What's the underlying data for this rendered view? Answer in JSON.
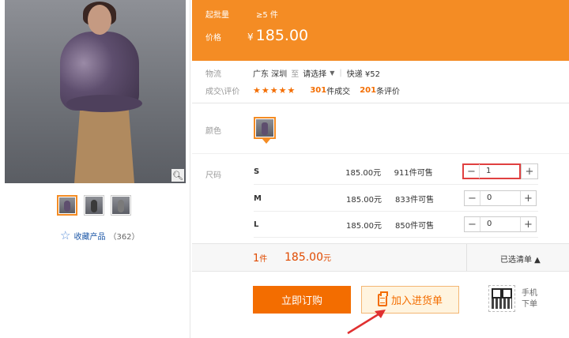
{
  "gallery": {
    "thumbnails": [
      "thumb-1",
      "thumb-2",
      "thumb-3"
    ],
    "favorite_label": "收藏产品",
    "favorite_count": "（362）"
  },
  "price_band": {
    "min_order_label": "起批量",
    "min_order_value": "≥5 件",
    "price_label": "价格",
    "currency": "¥",
    "price": "185.00"
  },
  "logistics": {
    "label": "物流",
    "origin": "广东 深圳",
    "to": "至",
    "destination": "请选择",
    "shipping": "快递 ¥52"
  },
  "reviews": {
    "label": "成交\\评价",
    "stars": "★★★★★",
    "deals_count": "301",
    "deals_label": "件成交",
    "reviews_count": "201",
    "reviews_label": "条评价"
  },
  "color": {
    "label": "颜色"
  },
  "sizes": {
    "label": "尺码",
    "rows": [
      {
        "name": "S",
        "price": "185.00元",
        "stock": "911件可售",
        "qty": "1"
      },
      {
        "name": "M",
        "price": "185.00元",
        "stock": "833件可售",
        "qty": "0"
      },
      {
        "name": "L",
        "price": "185.00元",
        "stock": "850件可售",
        "qty": "0"
      }
    ]
  },
  "summary": {
    "qty": "1",
    "qty_unit": "件",
    "total": "185.00",
    "total_unit": "元",
    "selected_label": "已选清单 ▲"
  },
  "actions": {
    "buy_label": "立即订购",
    "cart_label": "加入进货单",
    "mobile_line1": "手机",
    "mobile_line2": "下单"
  },
  "colors": {
    "accent": "#f48c24",
    "cta": "#f36d00",
    "highlight": "#e04040"
  }
}
